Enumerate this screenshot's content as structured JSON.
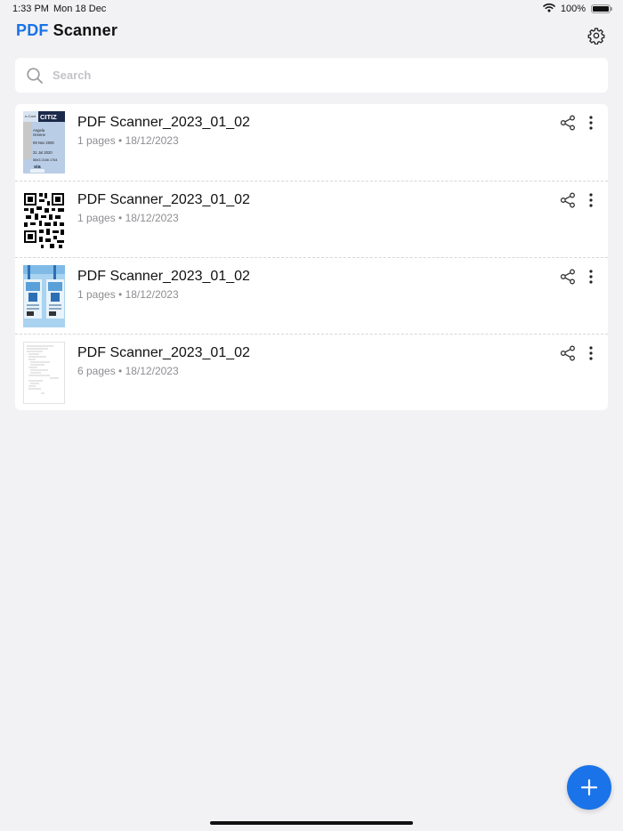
{
  "status_bar": {
    "time": "1:33 PM",
    "date": "Mon 18 Dec",
    "battery_text": "100%",
    "battery_level": 1.0,
    "icons": [
      "wifi-icon",
      "battery-icon"
    ]
  },
  "header": {
    "title_accent": "PDF",
    "title_rest": "Scanner",
    "settings_icon": "gear-icon",
    "accent_color": "#1a73e8"
  },
  "search": {
    "placeholder": "Search",
    "value": "",
    "icon": "search-icon"
  },
  "documents": [
    {
      "title": "PDF Scanner_2023_01_02",
      "pages": "1 pages",
      "date": "18/12/2023",
      "thumbnail": "id-card-thumbnail",
      "thumb_text": {
        "brand": "CITIZ",
        "name1": "Angela",
        "name2": "Greene",
        "date1": "09 Nov 2000",
        "date2": "31 Jul 2020",
        "number": "5843 2166 1764",
        "logo": "sia",
        "side": "e-Card"
      }
    },
    {
      "title": "PDF Scanner_2023_01_02",
      "pages": "1 pages",
      "date": "18/12/2023",
      "thumbnail": "qr-code-thumbnail"
    },
    {
      "title": "PDF Scanner_2023_01_02",
      "pages": "1 pages",
      "date": "18/12/2023",
      "thumbnail": "badges-thumbnail"
    },
    {
      "title": "PDF Scanner_2023_01_02",
      "pages": "6 pages",
      "date": "18/12/2023",
      "thumbnail": "text-page-thumbnail"
    }
  ],
  "row_actions": {
    "share_icon": "share-icon",
    "more_icon": "more-vertical-icon"
  },
  "fab": {
    "icon": "plus-icon",
    "color": "#1a73e8"
  }
}
